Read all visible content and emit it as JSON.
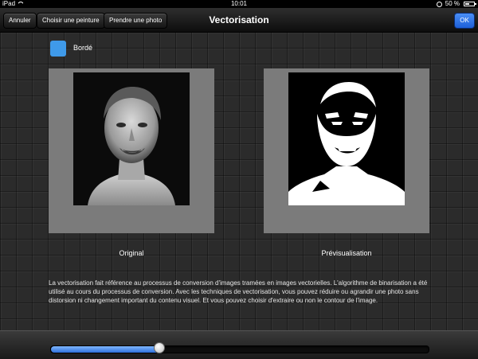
{
  "status_bar": {
    "device": "iPad",
    "time": "10:01",
    "battery_text": "50 %",
    "battery_level": 0.5
  },
  "nav": {
    "buttons": {
      "cancel": "Annuler",
      "choose_painting": "Choisir une peinture",
      "take_photo": "Prendre une photo"
    },
    "title": "Vectorisation",
    "ok": "OK"
  },
  "options": {
    "border_label": "Bordé",
    "border_checked": true
  },
  "images": {
    "original_label": "Original",
    "preview_label": "Prévisualisation"
  },
  "description": "La vectorisation fait référence au processus de conversion d'images tramées en images vectorielles. L'algorithme de binarisation a été utilisé au cours du processus de conversion. Avec les techniques de vectorisation, vous pouvez réduire ou agrandir une photo sans distorsion ni changement important du contenu visuel. Et vous pouvez choisir d'extraire ou non le contour de l'image.",
  "slider": {
    "value": 0.29
  },
  "colors": {
    "accent": "#3f9ae9",
    "ok_button": "#2a6fe0"
  }
}
